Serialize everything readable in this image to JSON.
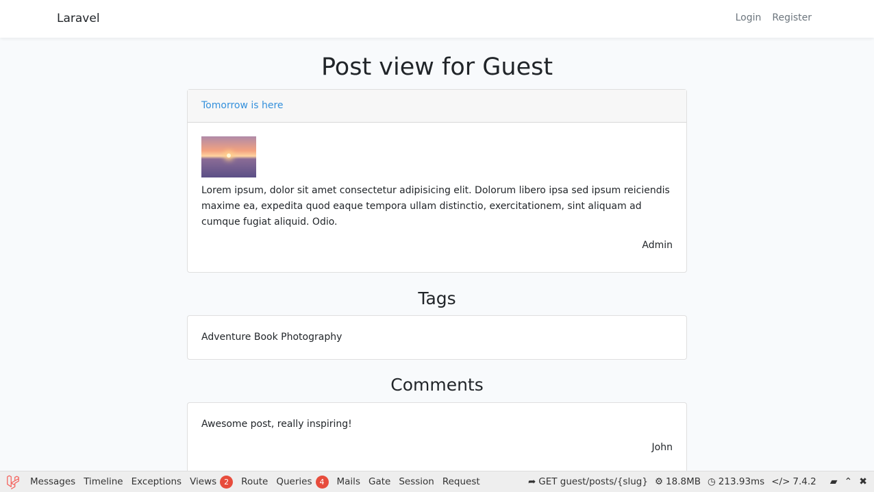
{
  "navbar": {
    "brand": "Laravel",
    "links": [
      "Login",
      "Register"
    ]
  },
  "page": {
    "title": "Post view for Guest"
  },
  "post": {
    "title": "Tomorrow is here",
    "body": "Lorem ipsum, dolor sit amet consectetur adipisicing elit. Dolorum libero ipsa sed ipsum reiciendis maxime ea, expedita quod eaque tempora ullam distinctio, exercitationem, sint aliquam ad cumque fugiat aliquid. Odio.",
    "author": "Admin"
  },
  "tags": {
    "title": "Tags",
    "list": "Adventure Book Photography"
  },
  "comments": {
    "title": "Comments",
    "items": [
      {
        "text": "Awesome post, really inspiring!",
        "author": "John"
      }
    ]
  },
  "debugbar": {
    "tabs": [
      {
        "label": "Messages"
      },
      {
        "label": "Timeline"
      },
      {
        "label": "Exceptions"
      },
      {
        "label": "Views",
        "badge": "2"
      },
      {
        "label": "Route"
      },
      {
        "label": "Queries",
        "badge": "4"
      },
      {
        "label": "Mails"
      },
      {
        "label": "Gate"
      },
      {
        "label": "Session"
      },
      {
        "label": "Request"
      }
    ],
    "route": "GET guest/posts/{slug}",
    "memory": "18.8MB",
    "time": "213.93ms",
    "php": "7.4.2"
  },
  "colors": {
    "link": "#3490dc",
    "badge": "#e74c3c",
    "laravel_red": "#f4645f"
  }
}
